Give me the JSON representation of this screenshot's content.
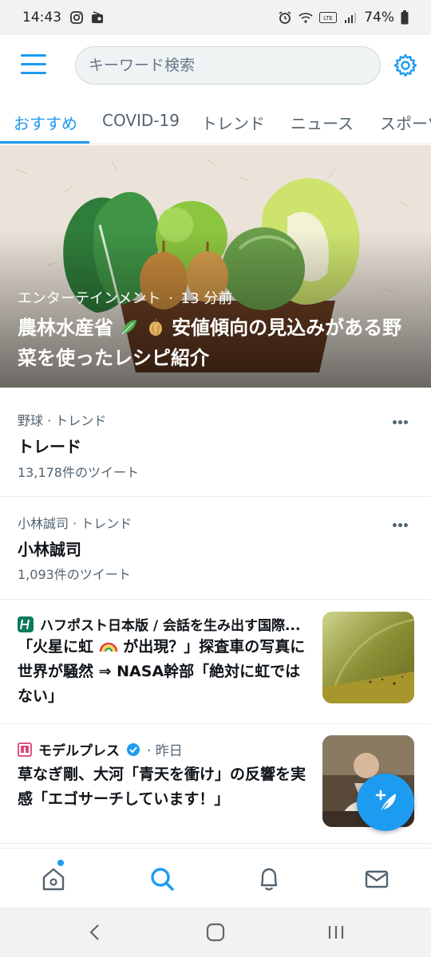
{
  "status_bar": {
    "time": "14:43",
    "battery": "74%"
  },
  "header": {
    "search_placeholder": "キーワード検索",
    "accent_color": "#1d9bf0"
  },
  "tabs": [
    {
      "label": "おすすめ",
      "active": true
    },
    {
      "label": "COVID-19",
      "active": false
    },
    {
      "label": "トレンド",
      "active": false
    },
    {
      "label": "ニュース",
      "active": false
    },
    {
      "label": "スポーツ",
      "active": false
    }
  ],
  "hero": {
    "category": "エンターテインメント",
    "separator": "·",
    "time": "13 分前",
    "title_part1": "農林水産省",
    "title_part2": "安値傾向の見込みがある野菜を使ったレシピ紹介"
  },
  "trends": [
    {
      "category": "野球 · トレンド",
      "name": "トレード",
      "count": "13,178件のツイート"
    },
    {
      "category": "小林誠司 · トレンド",
      "name": "小林誠司",
      "count": "1,093件のツイート"
    }
  ],
  "news": [
    {
      "source": "ハフポスト日本版 / 会話を生み出す国際...",
      "time": "",
      "title_part1": "「火星に虹",
      "title_part2": "が出現？」探査車の写真に世界が騒然 ⇒ NASA幹部「絶対に虹ではない」"
    },
    {
      "source": "モデルプレス",
      "time": "· 昨日",
      "title": "草なぎ剛、大河「青天を衝け」の反響を実感「エゴサーチしています！」"
    }
  ],
  "icons": {
    "status_left": [
      "instagram-icon",
      "radio-icon"
    ],
    "status_right": [
      "alarm-icon",
      "wifi-icon",
      "volte-icon",
      "signal-icon",
      "battery-icon"
    ],
    "bottom_nav": [
      "home-icon",
      "search-icon",
      "bell-icon",
      "mail-icon"
    ],
    "system_nav": [
      "back-icon",
      "home-circle-icon",
      "recents-icon"
    ]
  }
}
